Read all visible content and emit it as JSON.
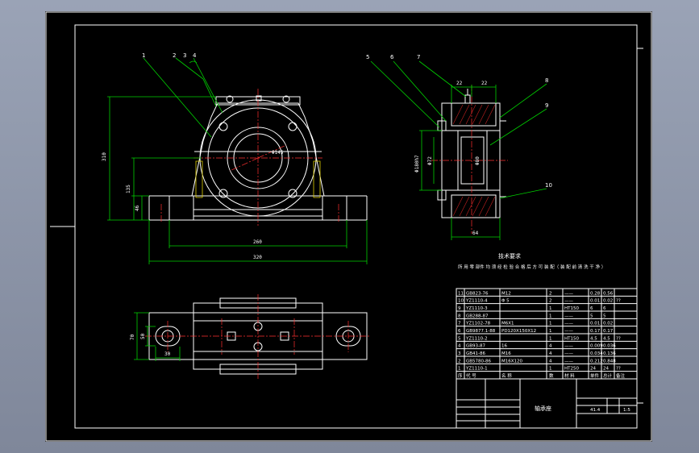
{
  "callouts": [
    "1",
    "2",
    "3",
    "4",
    "5",
    "6",
    "7",
    "8",
    "9",
    "10"
  ],
  "dims": {
    "front": [
      "Φ145",
      "310",
      "135",
      "46",
      "260",
      "320"
    ],
    "side": [
      "22",
      "22",
      "Φ180h7",
      "Φ72",
      "Φ80",
      "64"
    ],
    "bottom": [
      "70",
      "50",
      "30"
    ]
  },
  "notes": {
    "title": "技术要求",
    "line": "所 用 零 部件 均 须 经 检 验 合 格 后 方 可 装 配（ 装 配 前 清 洗 干 净 ）"
  },
  "bom": [
    [
      "11",
      "GB823-76",
      "M12",
      "2",
      "——",
      "0.28",
      "0.56",
      ""
    ],
    [
      "10",
      "YZ1110-4",
      "Φ 5",
      "2",
      "——",
      "0.01",
      "0.02",
      "??"
    ],
    [
      "9",
      "YZ1110-3",
      "",
      "1",
      "HT150",
      "6",
      "6",
      ""
    ],
    [
      "8",
      "GB288-87",
      "",
      "1",
      "——",
      "5",
      "5",
      ""
    ],
    [
      "7",
      "YZ1102-78",
      "M6X1",
      "1",
      "——",
      "0.01",
      "0.02",
      ""
    ],
    [
      "6",
      "GB9877.1-88",
      "PD120X150X12",
      "1",
      "——",
      "0.17",
      "0.17",
      ""
    ],
    [
      "5",
      "YZ1110-2",
      "",
      "1",
      "HT150",
      "4.5",
      "4.5",
      "??"
    ],
    [
      "4",
      "GB93-87",
      "16",
      "4",
      "——",
      "0.009",
      "0.036",
      ""
    ],
    [
      "3",
      "GB41-86",
      "M16",
      "4",
      "——",
      "0.034",
      "0.136",
      ""
    ],
    [
      "2",
      "GB5780-86",
      "M16X120",
      "4",
      "——",
      "0.212",
      "0.848",
      ""
    ],
    [
      "1",
      "YZ1110-1",
      "",
      "1",
      "HT250",
      "24",
      "24",
      "??"
    ]
  ],
  "bom_header": [
    "序",
    "代 号",
    "名 称",
    "数",
    "材 料",
    "单件",
    "总计",
    "备注"
  ],
  "titleblock": {
    "name": "轴承座",
    "scale": "1:5",
    "weight": "41.4"
  }
}
